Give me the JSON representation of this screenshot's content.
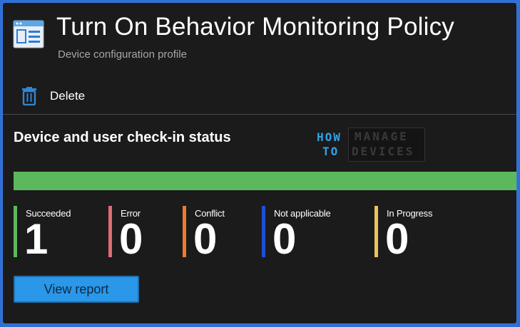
{
  "header": {
    "title": "Turn On Behavior Monitoring Policy",
    "subtitle": "Device configuration profile",
    "icon": "settings-page-icon"
  },
  "toolbar": {
    "delete_label": "Delete",
    "delete_icon": "trash-icon"
  },
  "section": {
    "title": "Device and user check-in status"
  },
  "watermark": {
    "how": "HOW",
    "to": "TO",
    "manage": "MANAGE",
    "devices": "DEVICES"
  },
  "status_bar": {
    "succeeded_fraction": 1.0,
    "color": "#5cb85c"
  },
  "stats": [
    {
      "label": "Succeeded",
      "value": "1",
      "color": "#5cb85c"
    },
    {
      "label": "Error",
      "value": "0",
      "color": "#e06c75"
    },
    {
      "label": "Conflict",
      "value": "0",
      "color": "#f07830"
    },
    {
      "label": "Not applicable",
      "value": "0",
      "color": "#1e4fd8"
    },
    {
      "label": "In Progress",
      "value": "0",
      "color": "#e8c45a"
    }
  ],
  "actions": {
    "view_report_label": "View report"
  }
}
